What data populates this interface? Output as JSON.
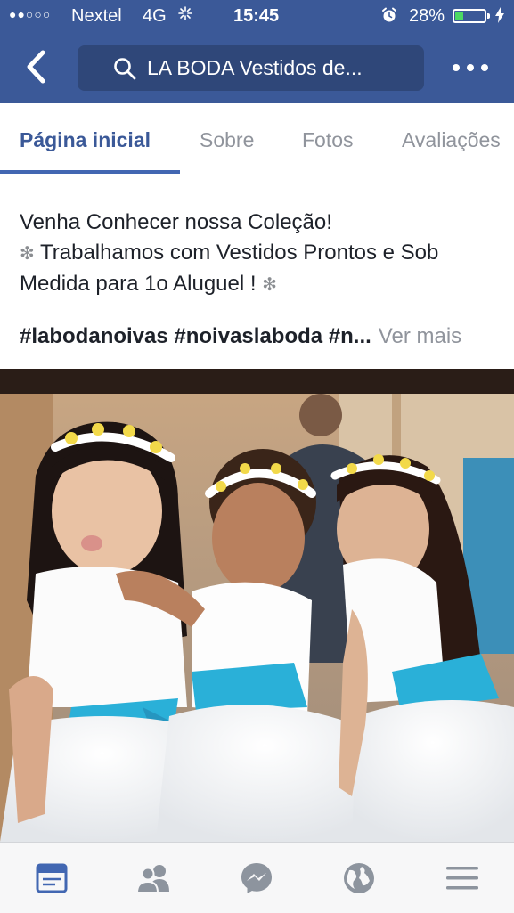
{
  "status_bar": {
    "carrier": "Nextel",
    "network": "4G",
    "time": "15:45",
    "battery_percent": "28%",
    "battery_level": 0.28,
    "signal_icon": "signal-dots-icon",
    "alarm_icon": "alarm-clock-icon",
    "charging_icon": "charging-bolt-icon"
  },
  "nav": {
    "back_icon": "chevron-left-icon",
    "search_text": "LA BODA Vestidos de...",
    "search_icon": "search-icon",
    "more_icon": "more-dots-icon"
  },
  "tabs": [
    {
      "label": "Página inicial",
      "active": true
    },
    {
      "label": "Sobre",
      "active": false
    },
    {
      "label": "Fotos",
      "active": false
    },
    {
      "label": "Avaliações",
      "active": false
    }
  ],
  "post": {
    "line1": "Venha Conhecer nossa Coleção!",
    "line2_text": " Trabalhamos com Vestidos Prontos e Sob",
    "line3_text": "Medida para 1o Aluguel ! ",
    "sparkle": "❇",
    "hashtags": "#labodanoivas #noivaslaboda #n...",
    "see_more": "Ver mais"
  },
  "photo": {
    "icon": "flower-girls-photo"
  },
  "bottom_bar": [
    {
      "icon": "news-feed-icon",
      "active": true
    },
    {
      "icon": "friends-icon",
      "active": false
    },
    {
      "icon": "messenger-icon",
      "active": false
    },
    {
      "icon": "globe-icon",
      "active": false
    },
    {
      "icon": "menu-icon",
      "active": false
    }
  ],
  "colors": {
    "brand": "#3b5998",
    "active_tab": "#4267b2",
    "text": "#1d2129",
    "muted": "#90949c",
    "sash": "#2ab0d8"
  }
}
